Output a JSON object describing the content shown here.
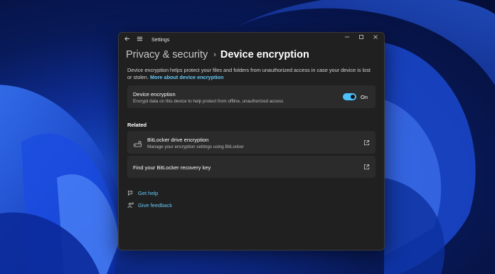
{
  "window": {
    "app_title": "Settings",
    "back_icon": "back-arrow-icon",
    "menu_icon": "hamburger-menu-icon"
  },
  "breadcrumb": {
    "parent": "Privacy & security",
    "separator": "›",
    "current": "Device encryption"
  },
  "description": {
    "text": "Device encryption helps protect your files and folders from unauthorized access in case your device is lost or stolen.",
    "link": "More about device encryption"
  },
  "encryption_card": {
    "title": "Device encryption",
    "subtitle": "Encrypt data on this device to help protect from offline, unauthorized access",
    "toggle_state": "On",
    "toggle_on": true
  },
  "related": {
    "label": "Related",
    "items": [
      {
        "title": "BitLocker drive encryption",
        "subtitle": "Manage your encryption settings using BitLocker",
        "icon": "drive-lock-icon",
        "action_icon": "external-link-icon"
      },
      {
        "title": "Find your BitLocker recovery key",
        "subtitle": "",
        "action_icon": "external-link-icon"
      }
    ]
  },
  "help": {
    "get_help": "Get help",
    "give_feedback": "Give feedback"
  },
  "colors": {
    "accent": "#4cc2ff",
    "link": "#64c8f5",
    "window_bg": "#202020",
    "card_bg": "#2b2b2b"
  }
}
